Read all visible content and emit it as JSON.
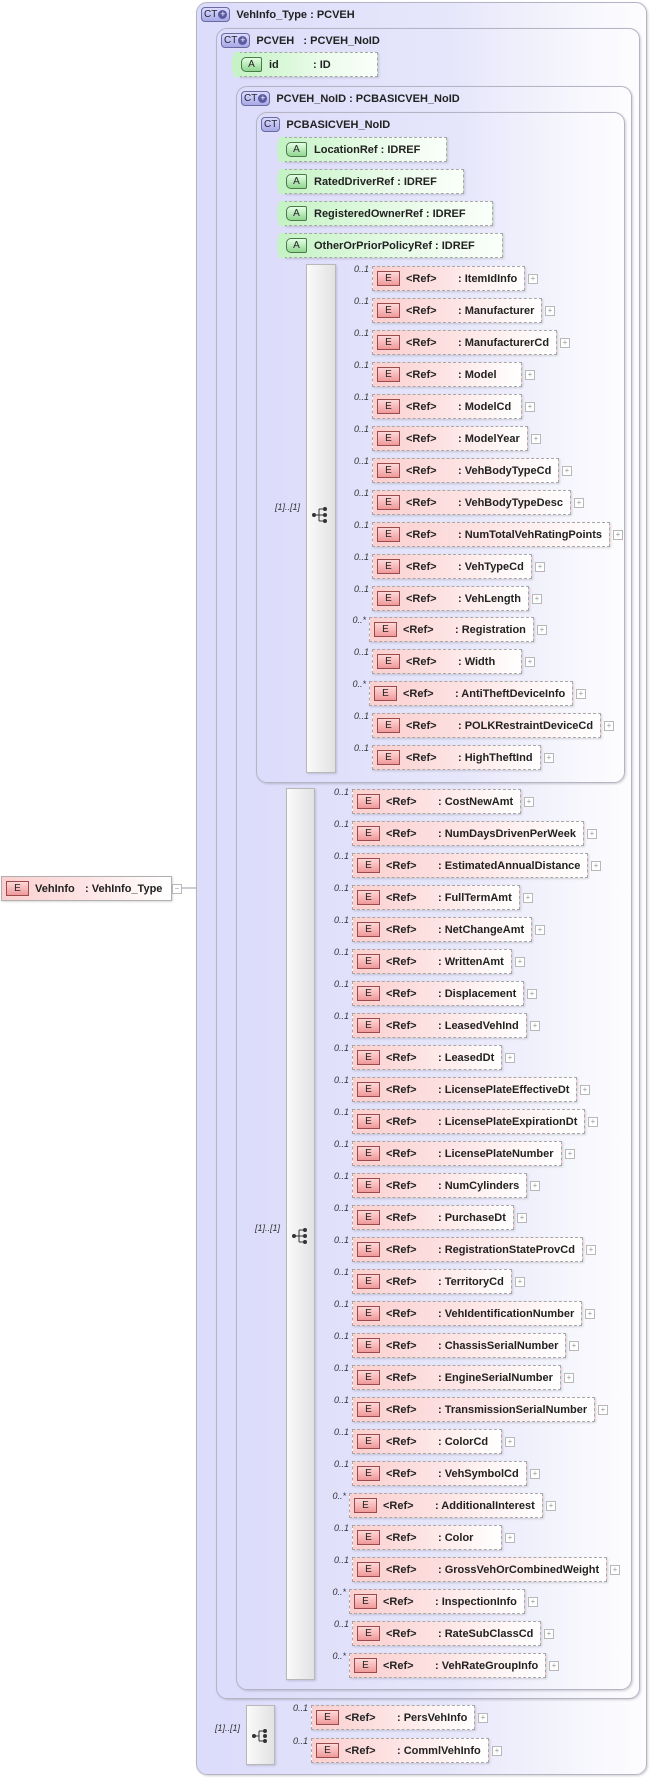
{
  "root_element": {
    "badge": "E",
    "name": "VehInfo",
    "type": ": VehInfo_Type",
    "collapse_icon": "minus"
  },
  "types": {
    "vehinfo_type": {
      "badge": "CT",
      "title": "VehInfo_Type : PCVEH"
    },
    "pcveh": {
      "badge": "CT",
      "title": "PCVEH   : PCVEH_NoID"
    },
    "pcveh_noid": {
      "badge": "CT",
      "title": "PCVEH_NoID : PCBASICVEH_NoID"
    },
    "pcbasicveh_noid": {
      "badge": "CT",
      "title": "PCBASICVEH_NoID"
    }
  },
  "id_attribute": {
    "badge": "A",
    "name": "id",
    "type": ": ID"
  },
  "attributes": [
    {
      "badge": "A",
      "label": "LocationRef : IDREF"
    },
    {
      "badge": "A",
      "label": "RatedDriverRef : IDREF"
    },
    {
      "badge": "A",
      "label": "RegisteredOwnerRef : IDREF"
    },
    {
      "badge": "A",
      "label": "OtherOrPriorPolicyRef : IDREF"
    }
  ],
  "groups": [
    {
      "kind": "sequence",
      "occurrence": "[1]..[1]",
      "items": [
        {
          "card": "0..1",
          "ref": "<Ref>",
          "name": ": ItemIdInfo"
        },
        {
          "card": "0..1",
          "ref": "<Ref>",
          "name": ": Manufacturer"
        },
        {
          "card": "0..1",
          "ref": "<Ref>",
          "name": ": ManufacturerCd"
        },
        {
          "card": "0..1",
          "ref": "<Ref>",
          "name": ": Model"
        },
        {
          "card": "0..1",
          "ref": "<Ref>",
          "name": ": ModelCd"
        },
        {
          "card": "0..1",
          "ref": "<Ref>",
          "name": ": ModelYear"
        },
        {
          "card": "0..1",
          "ref": "<Ref>",
          "name": ": VehBodyTypeCd"
        },
        {
          "card": "0..1",
          "ref": "<Ref>",
          "name": ": VehBodyTypeDesc"
        },
        {
          "card": "0..1",
          "ref": "<Ref>",
          "name": ": NumTotalVehRatingPoints"
        },
        {
          "card": "0..1",
          "ref": "<Ref>",
          "name": ": VehTypeCd"
        },
        {
          "card": "0..1",
          "ref": "<Ref>",
          "name": ": VehLength"
        },
        {
          "card": "0..*",
          "ref": "<Ref>",
          "name": ": Registration"
        },
        {
          "card": "0..1",
          "ref": "<Ref>",
          "name": ": Width"
        },
        {
          "card": "0..*",
          "ref": "<Ref>",
          "name": ": AntiTheftDeviceInfo"
        },
        {
          "card": "0..1",
          "ref": "<Ref>",
          "name": ": POLKRestraintDeviceCd"
        },
        {
          "card": "0..1",
          "ref": "<Ref>",
          "name": ": HighTheftInd"
        }
      ]
    },
    {
      "kind": "sequence",
      "occurrence": "[1]..[1]",
      "items": [
        {
          "card": "0..1",
          "ref": "<Ref>",
          "name": ": CostNewAmt"
        },
        {
          "card": "0..1",
          "ref": "<Ref>",
          "name": ": NumDaysDrivenPerWeek"
        },
        {
          "card": "0..1",
          "ref": "<Ref>",
          "name": ": EstimatedAnnualDistance"
        },
        {
          "card": "0..1",
          "ref": "<Ref>",
          "name": ": FullTermAmt"
        },
        {
          "card": "0..1",
          "ref": "<Ref>",
          "name": ": NetChangeAmt"
        },
        {
          "card": "0..1",
          "ref": "<Ref>",
          "name": ": WrittenAmt"
        },
        {
          "card": "0..1",
          "ref": "<Ref>",
          "name": ": Displacement"
        },
        {
          "card": "0..1",
          "ref": "<Ref>",
          "name": ": LeasedVehInd"
        },
        {
          "card": "0..1",
          "ref": "<Ref>",
          "name": ": LeasedDt"
        },
        {
          "card": "0..1",
          "ref": "<Ref>",
          "name": ": LicensePlateEffectiveDt"
        },
        {
          "card": "0..1",
          "ref": "<Ref>",
          "name": ": LicensePlateExpirationDt"
        },
        {
          "card": "0..1",
          "ref": "<Ref>",
          "name": ": LicensePlateNumber"
        },
        {
          "card": "0..1",
          "ref": "<Ref>",
          "name": ": NumCylinders"
        },
        {
          "card": "0..1",
          "ref": "<Ref>",
          "name": ": PurchaseDt"
        },
        {
          "card": "0..1",
          "ref": "<Ref>",
          "name": ": RegistrationStateProvCd"
        },
        {
          "card": "0..1",
          "ref": "<Ref>",
          "name": ": TerritoryCd"
        },
        {
          "card": "0..1",
          "ref": "<Ref>",
          "name": ": VehIdentificationNumber"
        },
        {
          "card": "0..1",
          "ref": "<Ref>",
          "name": ": ChassisSerialNumber"
        },
        {
          "card": "0..1",
          "ref": "<Ref>",
          "name": ": EngineSerialNumber"
        },
        {
          "card": "0..1",
          "ref": "<Ref>",
          "name": ": TransmissionSerialNumber"
        },
        {
          "card": "0..1",
          "ref": "<Ref>",
          "name": ": ColorCd"
        },
        {
          "card": "0..1",
          "ref": "<Ref>",
          "name": ": VehSymbolCd"
        },
        {
          "card": "0..*",
          "ref": "<Ref>",
          "name": ": AdditionalInterest"
        },
        {
          "card": "0..1",
          "ref": "<Ref>",
          "name": ": Color"
        },
        {
          "card": "0..1",
          "ref": "<Ref>",
          "name": ": GrossVehOrCombinedWeight"
        },
        {
          "card": "0..*",
          "ref": "<Ref>",
          "name": ": InspectionInfo"
        },
        {
          "card": "0..1",
          "ref": "<Ref>",
          "name": ": RateSubClassCd"
        },
        {
          "card": "0..*",
          "ref": "<Ref>",
          "name": ": VehRateGroupInfo"
        }
      ]
    },
    {
      "kind": "choice",
      "occurrence": "[1]..[1]",
      "items": [
        {
          "card": "0..1",
          "ref": "<Ref>",
          "name": ": PersVehInfo"
        },
        {
          "card": "0..1",
          "ref": "<Ref>",
          "name": ": CommlVehInfo"
        }
      ]
    }
  ],
  "colors": {
    "complex_type_bg": "#dcdcfb",
    "attribute_bg": "#c6f3c6",
    "element_bg": "#fbcfcf",
    "connector": "#9a9aa8"
  }
}
